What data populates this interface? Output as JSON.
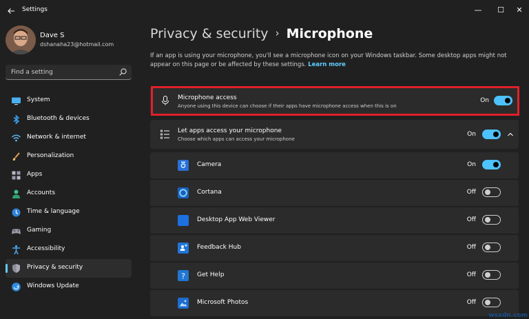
{
  "window": {
    "title": "Settings",
    "controls": {
      "minimize": "—",
      "maximize": "☐",
      "close": "✕"
    }
  },
  "profile": {
    "name": "Dave S",
    "email": "dshanaha23@hotmail.com"
  },
  "search": {
    "placeholder": "Find a setting"
  },
  "sidebar": {
    "items": [
      {
        "label": "System",
        "icon": "monitor-icon"
      },
      {
        "label": "Bluetooth & devices",
        "icon": "bluetooth-icon"
      },
      {
        "label": "Network & internet",
        "icon": "wifi-icon"
      },
      {
        "label": "Personalization",
        "icon": "brush-icon"
      },
      {
        "label": "Apps",
        "icon": "apps-icon"
      },
      {
        "label": "Accounts",
        "icon": "person-icon"
      },
      {
        "label": "Time & language",
        "icon": "globe-clock-icon"
      },
      {
        "label": "Gaming",
        "icon": "gamepad-icon"
      },
      {
        "label": "Accessibility",
        "icon": "accessibility-icon"
      },
      {
        "label": "Privacy & security",
        "icon": "shield-icon",
        "active": true
      },
      {
        "label": "Windows Update",
        "icon": "update-icon"
      }
    ]
  },
  "breadcrumb": {
    "parent": "Privacy & security",
    "separator": "›",
    "current": "Microphone"
  },
  "description": {
    "text": "If an app is using your microphone, you'll see a microphone icon on your Windows taskbar. Some desktop apps might not appear on this page or be affected by these settings.",
    "link": "Learn more"
  },
  "mic_access": {
    "title": "Microphone access",
    "subtitle": "Anyone using this device can choose if their apps have microphone access when this is on",
    "state": "On",
    "enabled": true
  },
  "apps_access": {
    "title": "Let apps access your microphone",
    "subtitle": "Choose which apps can access your microphone",
    "state": "On",
    "enabled": true
  },
  "apps": [
    {
      "name": "Camera",
      "state": "On",
      "enabled": true,
      "icon": "camera-icon",
      "color": "#2a6fd6"
    },
    {
      "name": "Cortana",
      "state": "Off",
      "enabled": false,
      "icon": "cortana-icon",
      "color": "#1b5fb8"
    },
    {
      "name": "Desktop App Web Viewer",
      "state": "Off",
      "enabled": false,
      "icon": "web-viewer-icon",
      "color": "#1e6fe0"
    },
    {
      "name": "Feedback Hub",
      "state": "Off",
      "enabled": false,
      "icon": "feedback-hub-icon",
      "color": "#1f75d8"
    },
    {
      "name": "Get Help",
      "state": "Off",
      "enabled": false,
      "icon": "get-help-icon",
      "color": "#2176d2"
    },
    {
      "name": "Microsoft Photos",
      "state": "Off",
      "enabled": false,
      "icon": "photos-icon",
      "color": "#1e6ccf"
    }
  ],
  "colors": {
    "accent": "#4cc2ff",
    "highlight_border": "#e0202a",
    "background": "#202020",
    "card": "#2b2b2b"
  },
  "watermark": "wsxdn.com"
}
